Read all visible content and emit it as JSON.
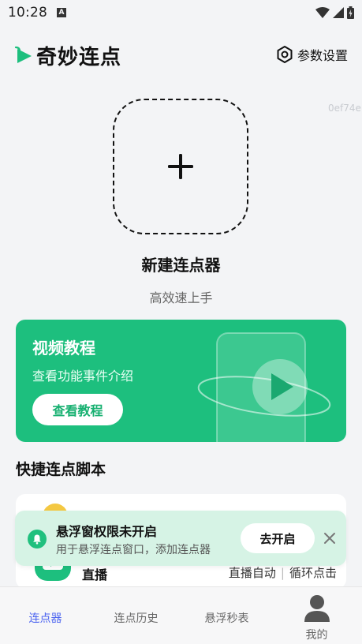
{
  "status_bar": {
    "time": "10:28",
    "a_icon": "A"
  },
  "header": {
    "title": "奇妙连点",
    "settings_label": "参数设置"
  },
  "device_id": "0ef74e",
  "new_clicker": {
    "title": "新建连点器",
    "subtitle": "高效速上手"
  },
  "video_card": {
    "title": "视频教程",
    "desc": "查看功能事件介绍",
    "button": "查看教程"
  },
  "section": {
    "title": "快捷连点脚本"
  },
  "script_item": {
    "name": "直播",
    "tag1": "直播自动",
    "tag2": "循环点击"
  },
  "toast": {
    "title": "悬浮窗权限未开启",
    "desc": "用于悬浮连点窗口，添加连点器",
    "button": "去开启"
  },
  "bottom_nav": {
    "items": [
      {
        "label": "连点器"
      },
      {
        "label": "连点历史"
      },
      {
        "label": "悬浮秒表"
      },
      {
        "label": "我的"
      }
    ]
  },
  "colors": {
    "accent": "#1dbf7e",
    "nav_active": "#4b63f0",
    "toast_bg": "#d6f3e5"
  }
}
